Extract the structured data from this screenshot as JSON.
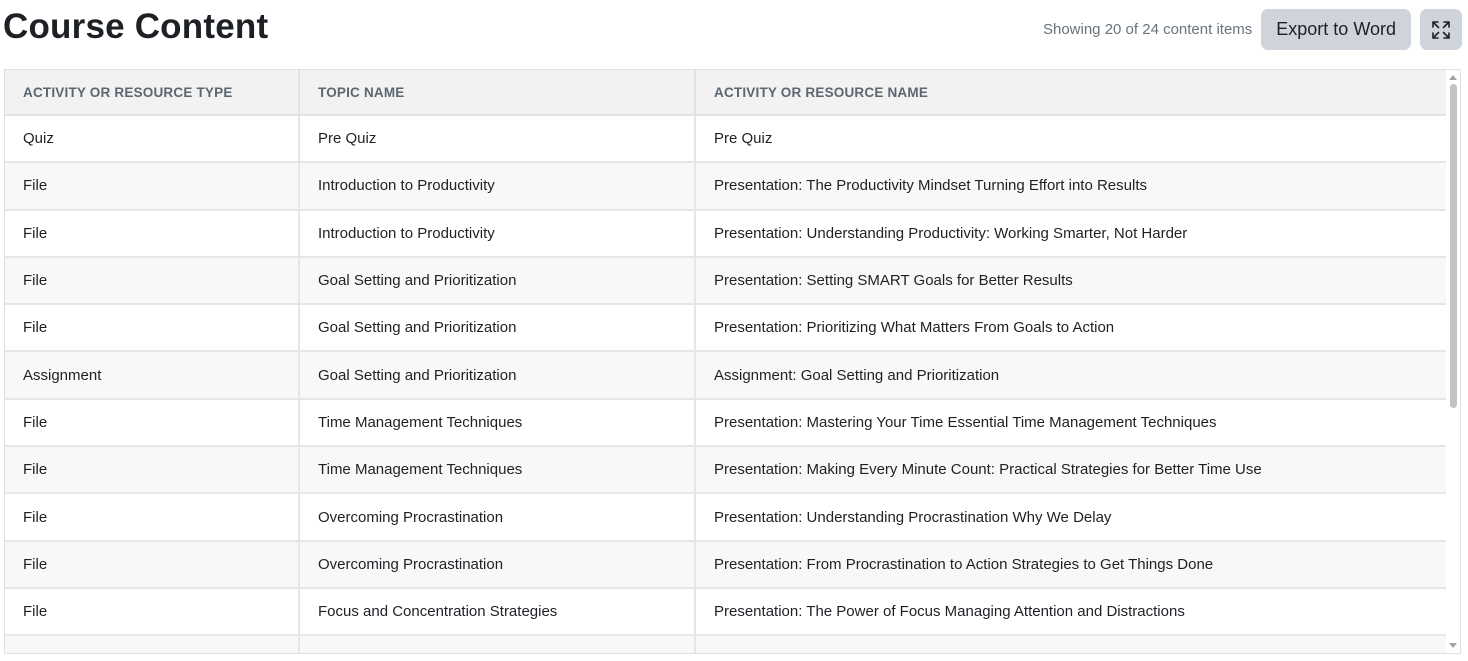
{
  "header": {
    "title": "Course Content",
    "count_text": "Showing 20 of 24 content items",
    "export_label": "Export to Word",
    "fullscreen_icon": "expand-icon"
  },
  "table": {
    "columns": [
      "ACTIVITY OR RESOURCE TYPE",
      "TOPIC NAME",
      "ACTIVITY OR RESOURCE NAME"
    ],
    "rows": [
      {
        "type": "Quiz",
        "topic": "Pre Quiz",
        "name": "Pre Quiz"
      },
      {
        "type": "File",
        "topic": "Introduction to Productivity",
        "name": "Presentation: The Productivity Mindset Turning Effort into Results"
      },
      {
        "type": "File",
        "topic": "Introduction to Productivity",
        "name": "Presentation: Understanding Productivity: Working Smarter, Not Harder"
      },
      {
        "type": "File",
        "topic": "Goal Setting and Prioritization",
        "name": "Presentation: Setting SMART Goals for Better Results"
      },
      {
        "type": "File",
        "topic": "Goal Setting and Prioritization",
        "name": "Presentation: Prioritizing What Matters From Goals to Action"
      },
      {
        "type": "Assignment",
        "topic": "Goal Setting and Prioritization",
        "name": "Assignment: Goal Setting and Prioritization"
      },
      {
        "type": "File",
        "topic": "Time Management Techniques",
        "name": "Presentation: Mastering Your Time Essential Time Management Techniques"
      },
      {
        "type": "File",
        "topic": "Time Management Techniques",
        "name": "Presentation: Making Every Minute Count: Practical Strategies for Better Time Use"
      },
      {
        "type": "File",
        "topic": "Overcoming Procrastination",
        "name": "Presentation: Understanding Procrastination Why We Delay"
      },
      {
        "type": "File",
        "topic": "Overcoming Procrastination",
        "name": "Presentation: From Procrastination to Action Strategies to Get Things Done"
      },
      {
        "type": "File",
        "topic": "Focus and Concentration Strategies",
        "name": "Presentation: The Power of Focus Managing Attention and Distractions"
      },
      {
        "type": "",
        "topic": "",
        "name": ""
      }
    ]
  },
  "colors": {
    "header_bg": "#f2f2f2",
    "even_row_bg": "#f8f8f8",
    "button_bg": "#ced4da"
  }
}
